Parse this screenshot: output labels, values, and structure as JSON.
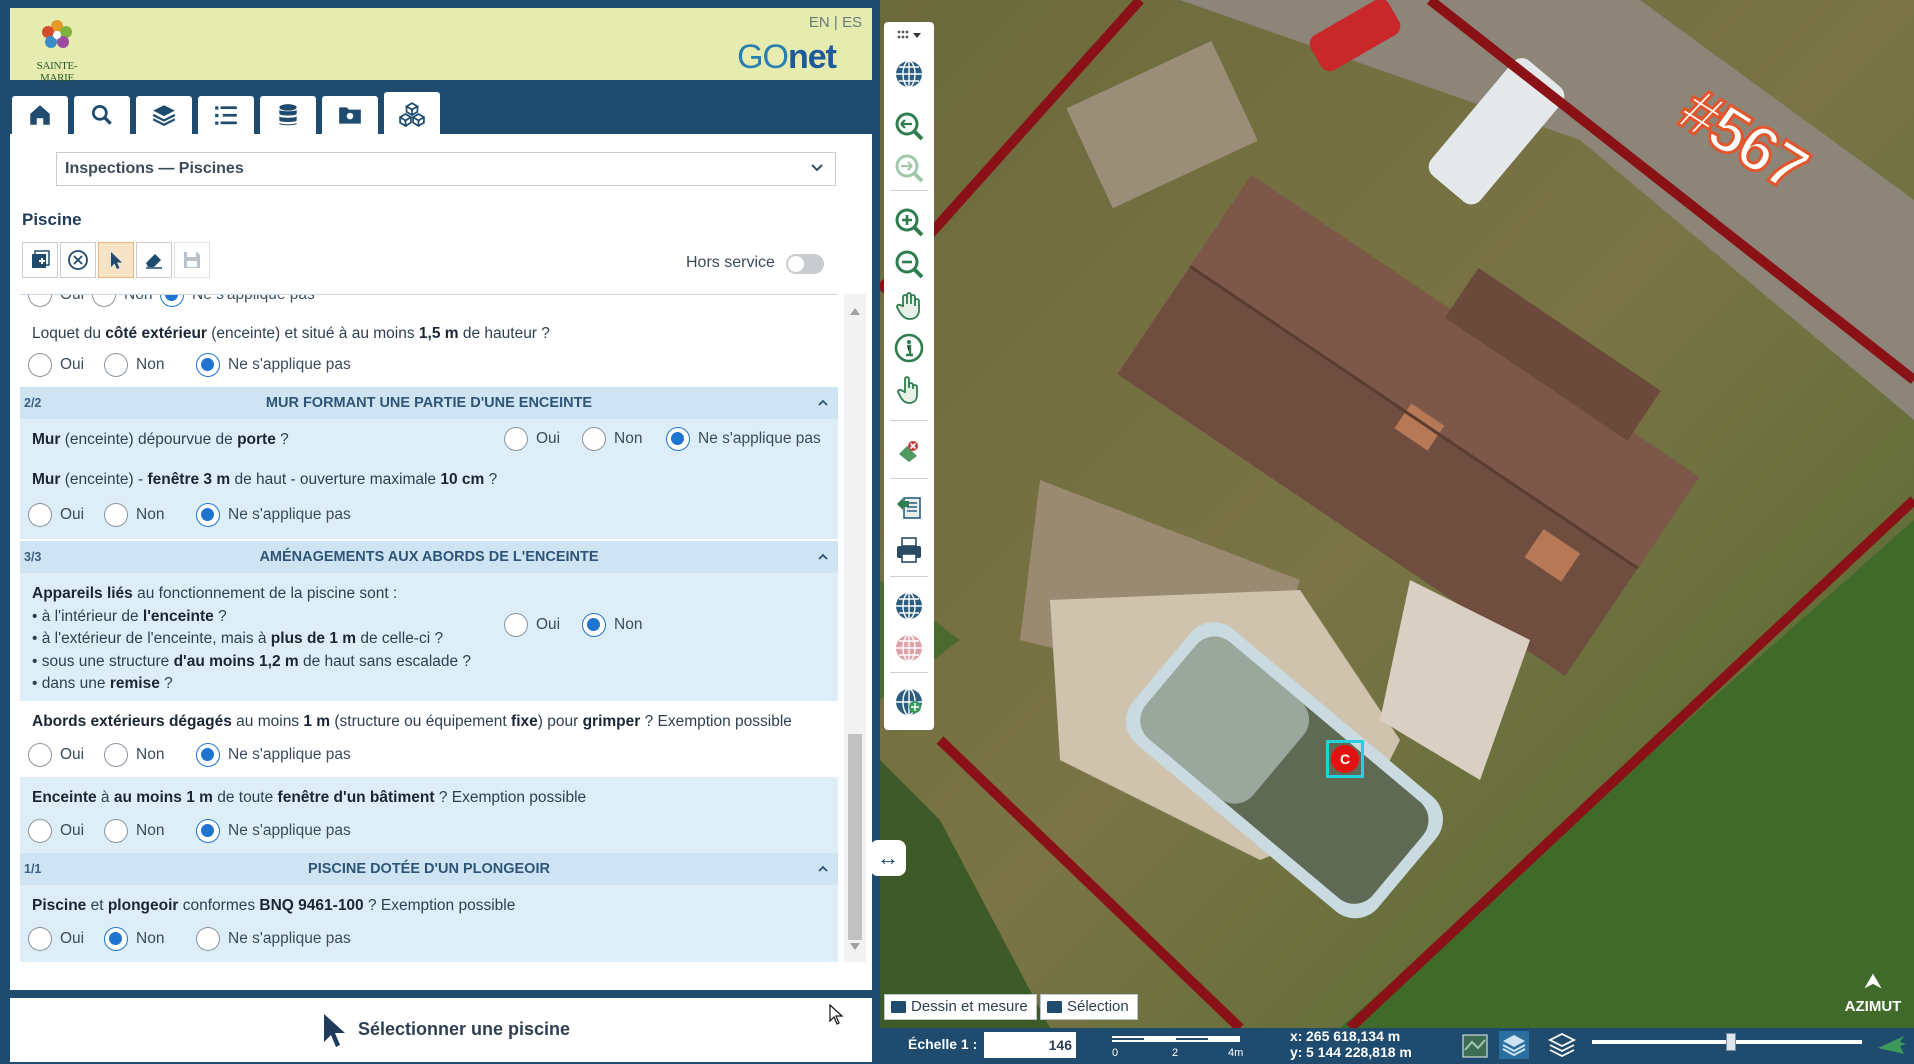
{
  "header": {
    "town": "SAINTE-MARIE",
    "lang": "EN | ES",
    "brand_a": "GO",
    "brand_b": "net"
  },
  "tabs": [
    {
      "icon": "home-icon"
    },
    {
      "icon": "search-icon"
    },
    {
      "icon": "layers-icon"
    },
    {
      "icon": "list-icon"
    },
    {
      "icon": "database-icon"
    },
    {
      "icon": "folder-icon"
    },
    {
      "icon": "cubes-icon",
      "active": true
    }
  ],
  "panel": {
    "dropdown": "Inspections — Piscines",
    "section_title": "Piscine",
    "hors_service": "Hors service"
  },
  "radio_labels": {
    "yes": "Oui",
    "no": "Non",
    "na": "Ne s'applique pas"
  },
  "form": {
    "q_loquet": {
      "a": "Loquet",
      "b": " du ",
      "c": "côté extérieur",
      "d": " (enceinte) et situé à au moins ",
      "e": "1,5 m",
      "f": " de hauteur ?"
    },
    "sec2": {
      "num": "2/2",
      "title": "MUR FORMANT UNE PARTIE D'UNE ENCEINTE"
    },
    "q_mur1": {
      "a": "Mur",
      "b": " (enceinte) dépourvue de ",
      "c": "porte",
      "d": " ?"
    },
    "q_mur2": {
      "a": "Mur",
      "b": " (enceinte) - ",
      "c": "fenêtre 3 m",
      "d": " de haut - ouverture maximale ",
      "e": "10 cm",
      "f": " ?"
    },
    "sec3": {
      "num": "3/3",
      "title": "AMÉNAGEMENTS AUX ABORDS DE L'ENCEINTE"
    },
    "q_app": {
      "l1a": "Appareils liés",
      "l1b": " au fonctionnement de la piscine sont :",
      "l2a": "• à l'intérieur de ",
      "l2b": "l'enceinte",
      "l2c": " ?",
      "l3a": "• à l'extérieur de l'enceinte, mais à ",
      "l3b": "plus de 1 m",
      "l3c": " de celle-ci ?",
      "l4a": "• sous une structure ",
      "l4b": "d'au moins 1,2 m",
      "l4c": " de haut sans escalade ?",
      "l5a": "• dans une ",
      "l5b": "remise",
      "l5c": " ?"
    },
    "q_abords": {
      "a": "Abords extérieurs dégagés",
      "b": " au moins ",
      "c": "1 m",
      "d": " (structure ou équipement ",
      "e": "fixe",
      "f": ") pour ",
      "g": "grimper",
      "h": " ? Exemption possible"
    },
    "q_enceinte": {
      "a": "Enceinte",
      "b": " à ",
      "c": "au moins 1 m",
      "d": " de toute ",
      "e": "fenêtre d'un bâtiment",
      "f": " ? Exemption possible"
    },
    "sec4": {
      "num": "1/1",
      "title": "PISCINE DOTÉE D'UN PLONGEOIR"
    },
    "q_plong": {
      "a": "Piscine",
      "b": " et ",
      "c": "plongeoir",
      "d": " conformes ",
      "e": "BNQ 9461-100",
      "f": " ? Exemption possible"
    }
  },
  "bottom": {
    "action": "Sélectionner une piscine"
  },
  "map": {
    "tab_draw": "Dessin et mesure",
    "tab_select": "Sélection",
    "scale_label": "Échelle 1 :",
    "scale_value": "146",
    "scale_ticks": [
      "0",
      "2",
      "4m"
    ],
    "coord_x_label": "x:",
    "coord_x": "265 618,134 m",
    "coord_y_label": "y:",
    "coord_y": "5 144 228,818 m",
    "lot_number": "#567",
    "marker_label": "C",
    "logo": "AZIMUT"
  },
  "colors": {
    "header": "#1f4b6e",
    "banner": "#e6ecb0",
    "section": "#cfe4f3",
    "accent": "#1f74d0"
  }
}
